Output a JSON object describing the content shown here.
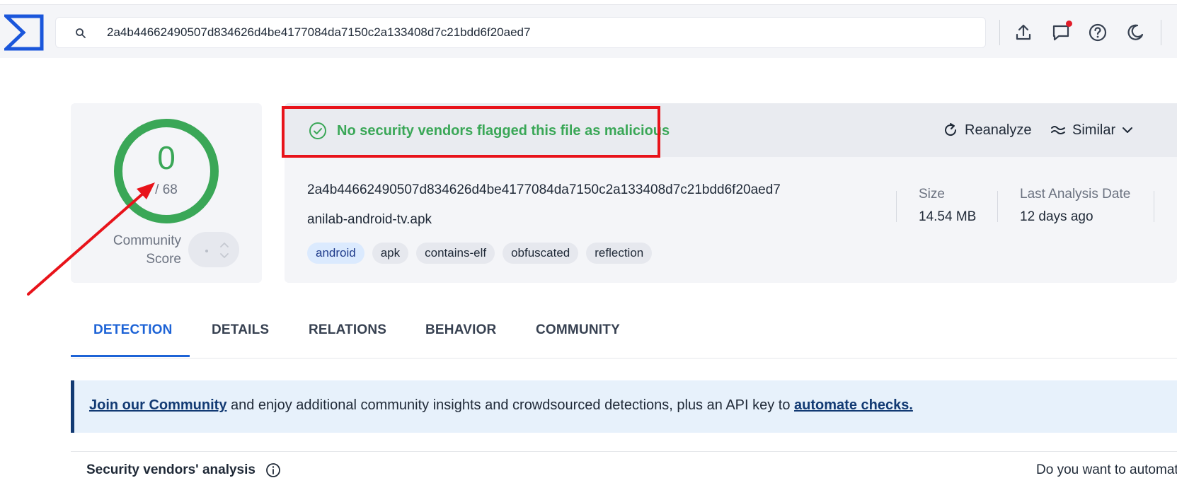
{
  "search": {
    "query": "2a4b44662490507d834626d4be4177084da7150c2a133408d7c21bdd6f20aed7",
    "icon": "search-icon"
  },
  "toolbar": {
    "icons": [
      "upload-icon",
      "chat-icon",
      "help-icon",
      "dark-mode-icon"
    ],
    "notification_dot_color": "#e11d2a"
  },
  "score": {
    "detections": "0",
    "total": "/ 68",
    "community_label_line1": "Community",
    "community_label_line2": "Score",
    "ring_color": "#3aa757"
  },
  "verdict": {
    "text": "No security vendors flagged this file as malicious",
    "color": "#3aa757"
  },
  "actions": {
    "reanalyze": "Reanalyze",
    "similar": "Similar"
  },
  "file": {
    "hash": "2a4b44662490507d834626d4be4177084da7150c2a133408d7c21bdd6f20aed7",
    "name": "anilab-android-tv.apk",
    "tags": [
      "android",
      "apk",
      "contains-elf",
      "obfuscated",
      "reflection"
    ]
  },
  "meta": {
    "size_label": "Size",
    "size_value": "14.54 MB",
    "date_label": "Last Analysis Date",
    "date_value": "12 days ago"
  },
  "tabs": [
    "DETECTION",
    "DETAILS",
    "RELATIONS",
    "BEHAVIOR",
    "COMMUNITY"
  ],
  "active_tab": "DETECTION",
  "banner": {
    "link1": "Join our Community",
    "middle": " and enjoy additional community insights and crowdsourced detections, plus an API key to ",
    "link2": "automate checks."
  },
  "section": {
    "title": "Security vendors' analysis",
    "automate_prompt": "Do you want to automate"
  },
  "annotation_color": "#e8131a",
  "accent_color": "#1d63d6"
}
